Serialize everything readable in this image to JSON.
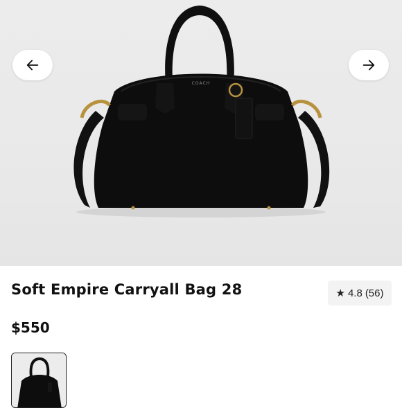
{
  "gallery": {
    "prev_icon": "arrow-left-icon",
    "next_icon": "arrow-right-icon",
    "brand_stamp": "COACH"
  },
  "product": {
    "title": "Soft Empire Carryall Bag 28",
    "price": "$550",
    "rating": {
      "icon": "star-icon",
      "star_glyph": "★",
      "value": "4.8",
      "count_text": "(56)"
    }
  },
  "colors": {
    "bag": "#0d0d0d",
    "hardware": "#b8923e",
    "background": "#ebebeb"
  }
}
